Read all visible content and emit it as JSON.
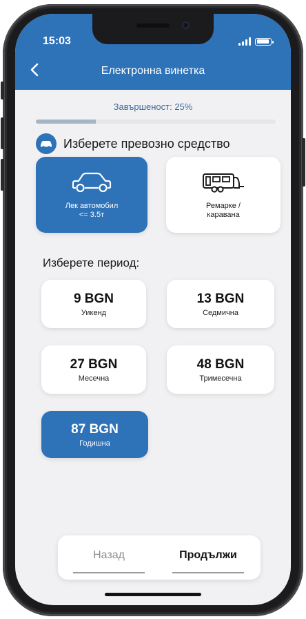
{
  "status": {
    "time": "15:03"
  },
  "header": {
    "title": "Електронна винетка",
    "back_icon": "chevron-left-icon"
  },
  "progress": {
    "label": "Завършеност: 25%",
    "percent": 25,
    "fill_color": "#a3b5c6"
  },
  "vehicle_section": {
    "title": "Изберете превозно средство",
    "icon": "car-icon",
    "options": [
      {
        "label": "Лек автомобил\n<= 3.5т",
        "icon": "car-icon",
        "selected": true
      },
      {
        "label": "Ремарке /\nкаравана",
        "icon": "caravan-icon",
        "selected": false
      }
    ]
  },
  "period_section": {
    "title": "Изберете период:",
    "options": [
      {
        "price": "9 BGN",
        "label": "Уикенд",
        "selected": false
      },
      {
        "price": "13 BGN",
        "label": "Седмична",
        "selected": false
      },
      {
        "price": "27 BGN",
        "label": "Месечна",
        "selected": false
      },
      {
        "price": "48 BGN",
        "label": "Тримесечна",
        "selected": false
      },
      {
        "price": "87 BGN",
        "label": "Годишна",
        "selected": true
      }
    ]
  },
  "footer": {
    "back_label": "Назад",
    "next_label": "Продължи"
  },
  "colors": {
    "accent": "#2e72b8",
    "background": "#f1f1f3",
    "card": "#ffffff"
  }
}
